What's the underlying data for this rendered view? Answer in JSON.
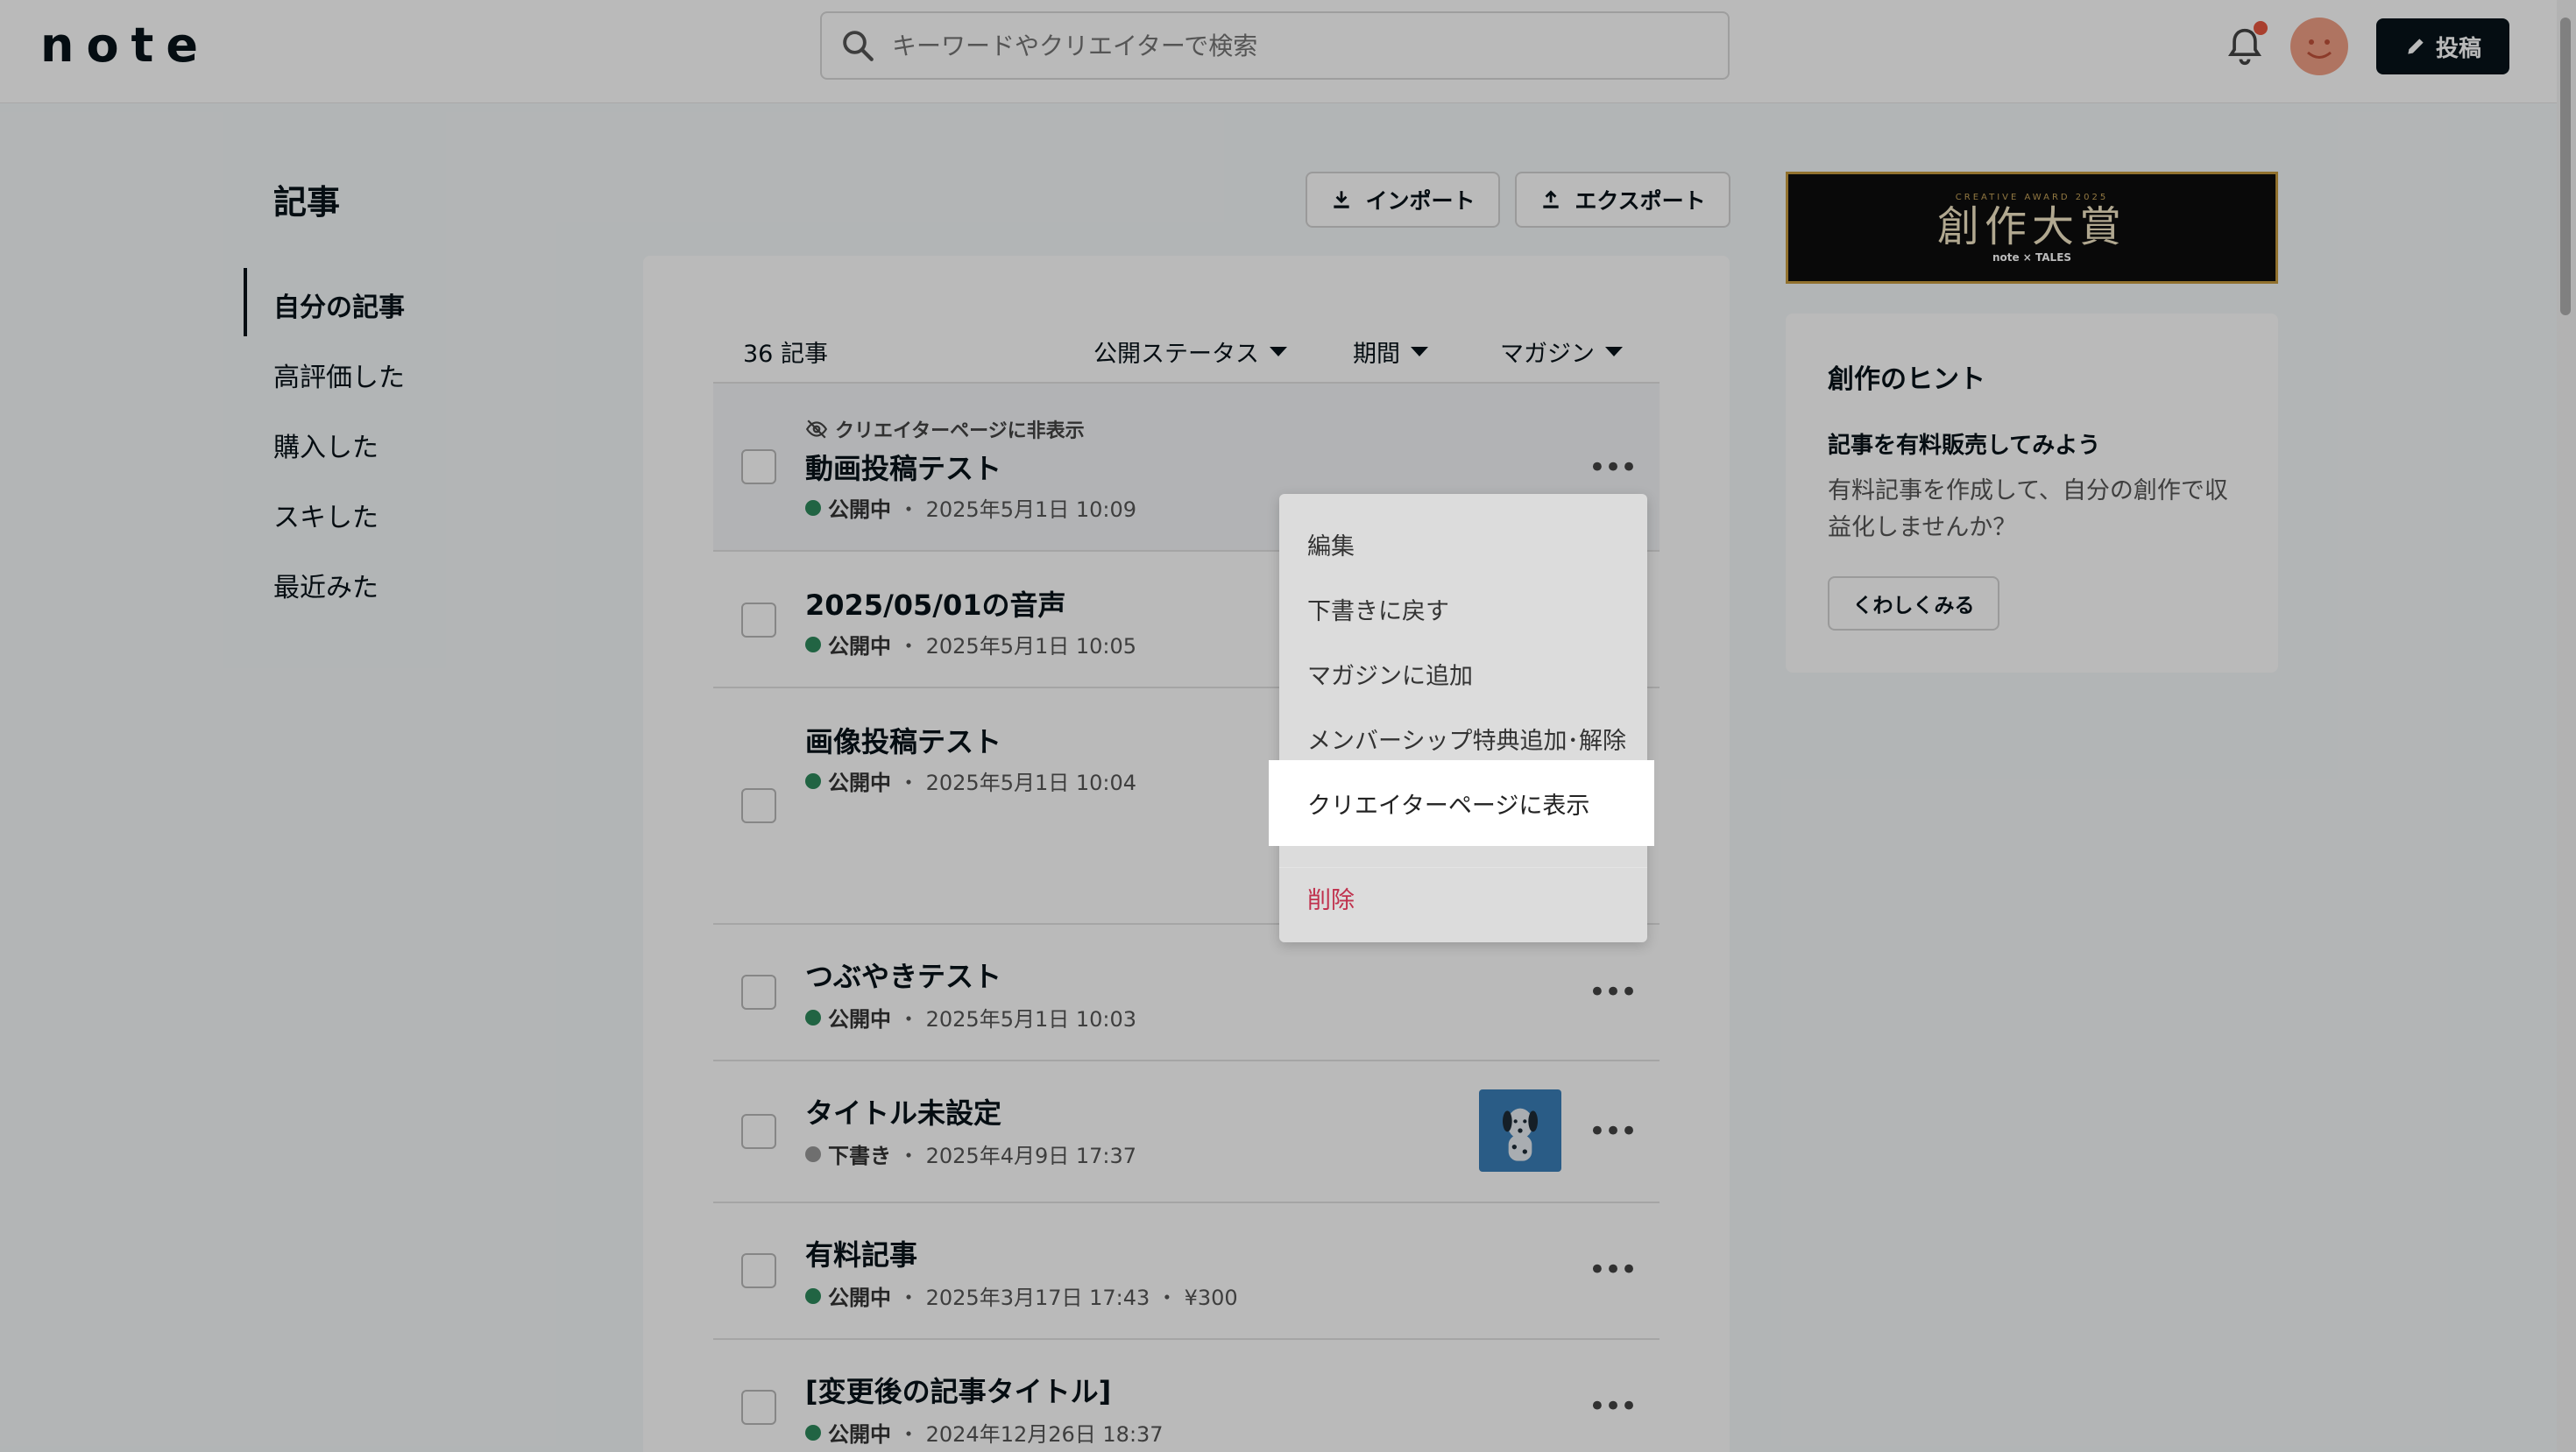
{
  "header": {
    "logo": "note",
    "search_placeholder": "キーワードやクリエイターで検索",
    "post_button": "投稿"
  },
  "page": {
    "title": "記事",
    "nav": [
      "自分の記事",
      "高評価した",
      "購入した",
      "スキした",
      "最近みた"
    ],
    "import_button": "インポート",
    "export_button": "エクスポート"
  },
  "list": {
    "count": "36 記事",
    "filters": [
      "公開ステータス",
      "期間",
      "マガジン"
    ],
    "hidden_note": "クリエイターページに非表示",
    "rows": [
      {
        "title": "動画投稿テスト",
        "status": "公開中",
        "date": "・ 2025年5月1日 10:09"
      },
      {
        "title": "2025/05/01の音声",
        "status": "公開中",
        "date": "・ 2025年5月1日 10:05"
      },
      {
        "title": "画像投稿テスト",
        "status": "公開中",
        "date": "・ 2025年5月1日 10:04"
      },
      {
        "title": "つぶやきテスト",
        "status": "公開中",
        "date": "・ 2025年5月1日 10:03"
      },
      {
        "title": "タイトル未設定",
        "status": "下書き",
        "date": "・ 2025年4月9日 17:37"
      },
      {
        "title": "有料記事",
        "status": "公開中",
        "date": "・ 2025年3月17日 17:43 ・ ¥300"
      },
      {
        "title": "[変更後の記事タイトル]",
        "status": "公開中",
        "date": "・ 2024年12月26日 18:37"
      }
    ]
  },
  "menu": {
    "items": [
      "編集",
      "下書きに戻す",
      "マガジンに追加",
      "メンバーシップ特典追加･解除",
      "クリエイターページに表示"
    ],
    "delete": "削除"
  },
  "sidebar": {
    "banner_small": "CREATIVE AWARD 2025",
    "banner_main": "創作大賞",
    "banner_sub": "note × TALES",
    "hint_title": "創作のヒント",
    "hint_subtitle": "記事を有料販売してみよう",
    "hint_text": "有料記事を作成して、自分の創作で収益化しませんか？",
    "hint_button": "くわしくみる"
  },
  "colors": {
    "published": "#2e8a5c",
    "draft": "#999999",
    "delete": "#c0314d",
    "accent": "#08131a"
  }
}
